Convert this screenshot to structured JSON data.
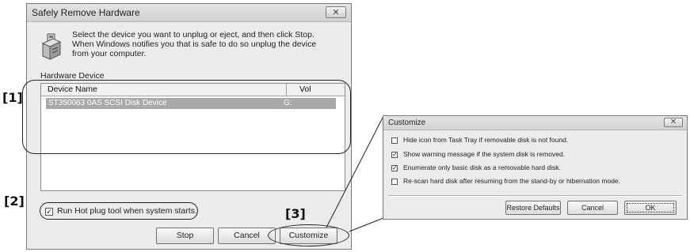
{
  "main_dialog": {
    "title": "Safely Remove Hardware",
    "close_glyph": "✕",
    "icon": "hardware-device-icon",
    "instruction": "Select the device you want to unplug or eject, and then click Stop. When Windows notifies you that is safe to do so unplug the device from your computer.",
    "hardware_label": "Hardware Device",
    "columns": {
      "name": "Device Name",
      "vol": "Vol"
    },
    "devices": [
      {
        "name": "ST350063 0AS SCSI Disk Device",
        "vol": "G:"
      }
    ],
    "run_hotplug_label": "Run Hot plug tool when system starts.",
    "run_hotplug_checked": true,
    "buttons": {
      "stop": "Stop",
      "cancel": "Cancel",
      "customize": "Customize"
    }
  },
  "callouts": {
    "one": "[1]",
    "two": "[2]",
    "three": "[3]"
  },
  "customize_dialog": {
    "title": "Customize",
    "close_glyph": "✕",
    "options": [
      {
        "label": "Hide icon from Task Tray if removable disk is not found.",
        "checked": false
      },
      {
        "label": "Show warning message if the system disk is removed.",
        "checked": true
      },
      {
        "label": "Enumerate only basic disk as a removable hard disk.",
        "checked": true
      },
      {
        "label": "Re-scan hard disk after resuming from the stand-by or hibernation mode.",
        "checked": false
      }
    ],
    "buttons": {
      "restore": "Restore Defaults",
      "cancel": "Cancel",
      "ok": "OK"
    }
  },
  "colors": {
    "selection": "#a9a9a9",
    "dialog_bg": "#ececec"
  }
}
